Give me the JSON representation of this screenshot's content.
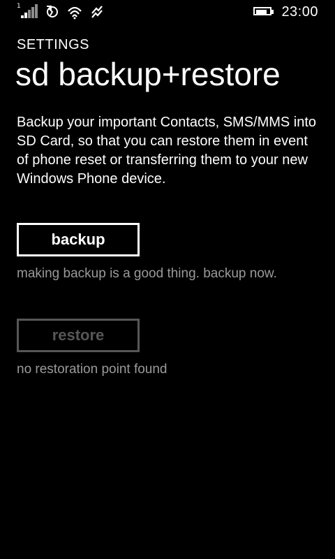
{
  "status_bar": {
    "sim_number": "1",
    "time": "23:00",
    "battery_level": 0.85,
    "icons": [
      "signal-icon",
      "sync-icon",
      "wifi-icon",
      "data-icon",
      "battery-icon"
    ]
  },
  "header": {
    "section": "SETTINGS",
    "title": "sd backup+restore"
  },
  "content": {
    "description": "Backup your important Contacts, SMS/MMS into SD Card, so that you can restore them in event of phone reset or transferring them to your new Windows Phone device.",
    "backup_label": "backup",
    "backup_hint": "making backup is a good thing. backup now.",
    "restore_label": "restore",
    "restore_hint": "no restoration point found"
  },
  "colors": {
    "background": "#000000",
    "text": "#ffffff",
    "hint": "#9a9a9a",
    "disabled": "#575757"
  }
}
